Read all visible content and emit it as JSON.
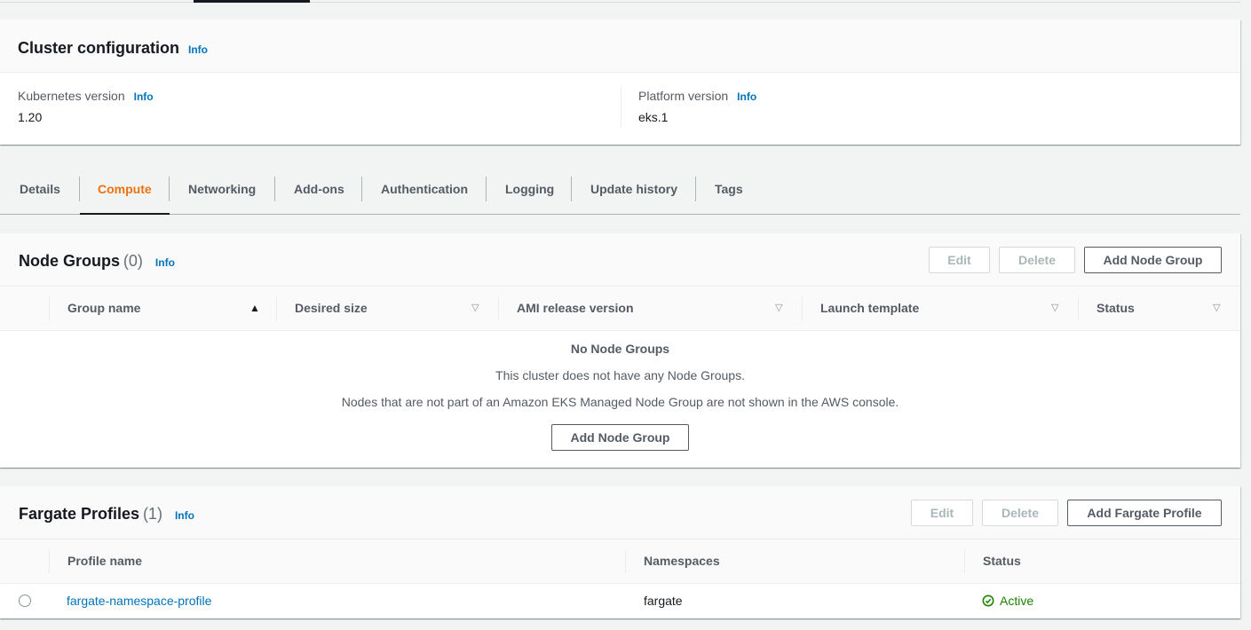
{
  "cluster_config": {
    "title": "Cluster configuration",
    "info": "Info",
    "k8s_label": "Kubernetes version",
    "k8s_value": "1.20",
    "platform_label": "Platform version",
    "platform_value": "eks.1"
  },
  "tabs": [
    {
      "label": "Details"
    },
    {
      "label": "Compute"
    },
    {
      "label": "Networking"
    },
    {
      "label": "Add-ons"
    },
    {
      "label": "Authentication"
    },
    {
      "label": "Logging"
    },
    {
      "label": "Update history"
    },
    {
      "label": "Tags"
    }
  ],
  "active_tab": "Compute",
  "node_groups": {
    "title": "Node Groups",
    "count": "(0)",
    "info": "Info",
    "edit": "Edit",
    "delete": "Delete",
    "add": "Add Node Group",
    "columns": [
      "Group name",
      "Desired size",
      "AMI release version",
      "Launch template",
      "Status"
    ],
    "empty_title": "No Node Groups",
    "empty_desc": "This cluster does not have any Node Groups.",
    "empty_note": "Nodes that are not part of an Amazon EKS Managed Node Group are not shown in the AWS console.",
    "empty_add": "Add Node Group"
  },
  "fargate": {
    "title": "Fargate Profiles",
    "count": "(1)",
    "info": "Info",
    "edit": "Edit",
    "delete": "Delete",
    "add": "Add Fargate Profile",
    "columns": [
      "Profile name",
      "Namespaces",
      "Status"
    ],
    "rows": [
      {
        "name": "fargate-namespace-profile",
        "namespace": "fargate",
        "status": "Active"
      }
    ]
  },
  "colors": {
    "accent": "#ec7211",
    "link": "#0073bb",
    "success": "#1d8102"
  }
}
